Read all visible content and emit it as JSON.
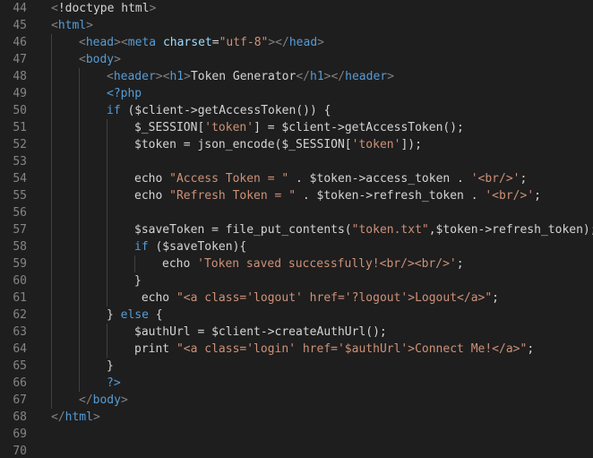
{
  "editor": {
    "colors": {
      "background": "#1e1e1e",
      "line_number": "#858585",
      "tag": "#569cd6",
      "punctuation": "#808080",
      "attribute": "#9cdcfe",
      "string": "#ce9178",
      "keyword": "#569cd6",
      "text": "#d4d4d4"
    },
    "lines": [
      {
        "num": "44",
        "indent": 0,
        "tokens": [
          {
            "t": "punc",
            "v": "<"
          },
          {
            "t": "plain",
            "v": "!doctype html"
          },
          {
            "t": "punc",
            "v": ">"
          }
        ]
      },
      {
        "num": "45",
        "indent": 0,
        "tokens": [
          {
            "t": "punc",
            "v": "<"
          },
          {
            "t": "tag",
            "v": "html"
          },
          {
            "t": "punc",
            "v": ">"
          }
        ]
      },
      {
        "num": "46",
        "indent": 1,
        "tokens": [
          {
            "t": "punc",
            "v": "<"
          },
          {
            "t": "tag",
            "v": "head"
          },
          {
            "t": "punc",
            "v": "><"
          },
          {
            "t": "tag",
            "v": "meta"
          },
          {
            "t": "plain",
            "v": " "
          },
          {
            "t": "attr",
            "v": "charset"
          },
          {
            "t": "plain",
            "v": "="
          },
          {
            "t": "str",
            "v": "\"utf-8\""
          },
          {
            "t": "punc",
            "v": "></"
          },
          {
            "t": "tag",
            "v": "head"
          },
          {
            "t": "punc",
            "v": ">"
          }
        ]
      },
      {
        "num": "47",
        "indent": 1,
        "tokens": [
          {
            "t": "punc",
            "v": "<"
          },
          {
            "t": "tag",
            "v": "body"
          },
          {
            "t": "punc",
            "v": ">"
          }
        ]
      },
      {
        "num": "48",
        "indent": 2,
        "tokens": [
          {
            "t": "punc",
            "v": "<"
          },
          {
            "t": "tag",
            "v": "header"
          },
          {
            "t": "punc",
            "v": "><"
          },
          {
            "t": "tag",
            "v": "h1"
          },
          {
            "t": "punc",
            "v": ">"
          },
          {
            "t": "plain",
            "v": "Token Generator"
          },
          {
            "t": "punc",
            "v": "</"
          },
          {
            "t": "tag",
            "v": "h1"
          },
          {
            "t": "punc",
            "v": "></"
          },
          {
            "t": "tag",
            "v": "header"
          },
          {
            "t": "punc",
            "v": ">"
          }
        ]
      },
      {
        "num": "49",
        "indent": 2,
        "tokens": [
          {
            "t": "php",
            "v": "<?php"
          }
        ]
      },
      {
        "num": "50",
        "indent": 2,
        "tokens": [
          {
            "t": "kw",
            "v": "if"
          },
          {
            "t": "plain",
            "v": " ($client->getAccessToken()) {"
          }
        ]
      },
      {
        "num": "51",
        "indent": 3,
        "tokens": [
          {
            "t": "plain",
            "v": "$_SESSION["
          },
          {
            "t": "str",
            "v": "'token'"
          },
          {
            "t": "plain",
            "v": "] = $client->getAccessToken();"
          }
        ]
      },
      {
        "num": "52",
        "indent": 3,
        "tokens": [
          {
            "t": "plain",
            "v": "$token = json_encode($_SESSION["
          },
          {
            "t": "str",
            "v": "'token'"
          },
          {
            "t": "plain",
            "v": "]);"
          }
        ]
      },
      {
        "num": "53",
        "indent": 3,
        "tokens": []
      },
      {
        "num": "54",
        "indent": 3,
        "tokens": [
          {
            "t": "plain",
            "v": "echo "
          },
          {
            "t": "str",
            "v": "\"Access Token = \""
          },
          {
            "t": "plain",
            "v": " . $token->access_token . "
          },
          {
            "t": "str",
            "v": "'<br/>'"
          },
          {
            "t": "plain",
            "v": ";"
          }
        ]
      },
      {
        "num": "55",
        "indent": 3,
        "tokens": [
          {
            "t": "plain",
            "v": "echo "
          },
          {
            "t": "str",
            "v": "\"Refresh Token = \""
          },
          {
            "t": "plain",
            "v": " . $token->refresh_token . "
          },
          {
            "t": "str",
            "v": "'<br/>'"
          },
          {
            "t": "plain",
            "v": ";"
          }
        ]
      },
      {
        "num": "56",
        "indent": 3,
        "tokens": []
      },
      {
        "num": "57",
        "indent": 3,
        "tokens": [
          {
            "t": "plain",
            "v": "$saveToken = file_put_contents("
          },
          {
            "t": "str",
            "v": "\"token.txt\""
          },
          {
            "t": "plain",
            "v": ",$token->refresh_token);"
          }
        ]
      },
      {
        "num": "58",
        "indent": 3,
        "tokens": [
          {
            "t": "kw",
            "v": "if"
          },
          {
            "t": "plain",
            "v": " ($saveToken){"
          }
        ]
      },
      {
        "num": "59",
        "indent": 4,
        "tokens": [
          {
            "t": "plain",
            "v": "echo "
          },
          {
            "t": "str",
            "v": "'Token saved successfully!<br/><br/>'"
          },
          {
            "t": "plain",
            "v": ";"
          }
        ]
      },
      {
        "num": "60",
        "indent": 3,
        "tokens": [
          {
            "t": "plain",
            "v": "}"
          }
        ]
      },
      {
        "num": "61",
        "indent": 3,
        "tokens": [
          {
            "t": "plain",
            "v": " echo "
          },
          {
            "t": "str",
            "v": "\"<a class='logout' href='?logout'>Logout</a>\""
          },
          {
            "t": "plain",
            "v": ";"
          }
        ]
      },
      {
        "num": "62",
        "indent": 2,
        "tokens": [
          {
            "t": "plain",
            "v": "} "
          },
          {
            "t": "kw",
            "v": "else"
          },
          {
            "t": "plain",
            "v": " {"
          }
        ]
      },
      {
        "num": "63",
        "indent": 3,
        "tokens": [
          {
            "t": "plain",
            "v": "$authUrl = $client->createAuthUrl();"
          }
        ]
      },
      {
        "num": "64",
        "indent": 3,
        "tokens": [
          {
            "t": "plain",
            "v": "print "
          },
          {
            "t": "str",
            "v": "\"<a class='login' href='$authUrl'>Connect Me!</a>\""
          },
          {
            "t": "plain",
            "v": ";"
          }
        ]
      },
      {
        "num": "65",
        "indent": 2,
        "tokens": [
          {
            "t": "plain",
            "v": "}"
          }
        ]
      },
      {
        "num": "66",
        "indent": 2,
        "tokens": [
          {
            "t": "php",
            "v": "?>"
          }
        ]
      },
      {
        "num": "67",
        "indent": 1,
        "tokens": [
          {
            "t": "punc",
            "v": "</"
          },
          {
            "t": "tag",
            "v": "body"
          },
          {
            "t": "punc",
            "v": ">"
          }
        ]
      },
      {
        "num": "68",
        "indent": 0,
        "tokens": [
          {
            "t": "punc",
            "v": "</"
          },
          {
            "t": "tag",
            "v": "html"
          },
          {
            "t": "punc",
            "v": ">"
          }
        ]
      },
      {
        "num": "69",
        "indent": 0,
        "tokens": []
      },
      {
        "num": "70",
        "indent": 0,
        "tokens": []
      }
    ]
  }
}
